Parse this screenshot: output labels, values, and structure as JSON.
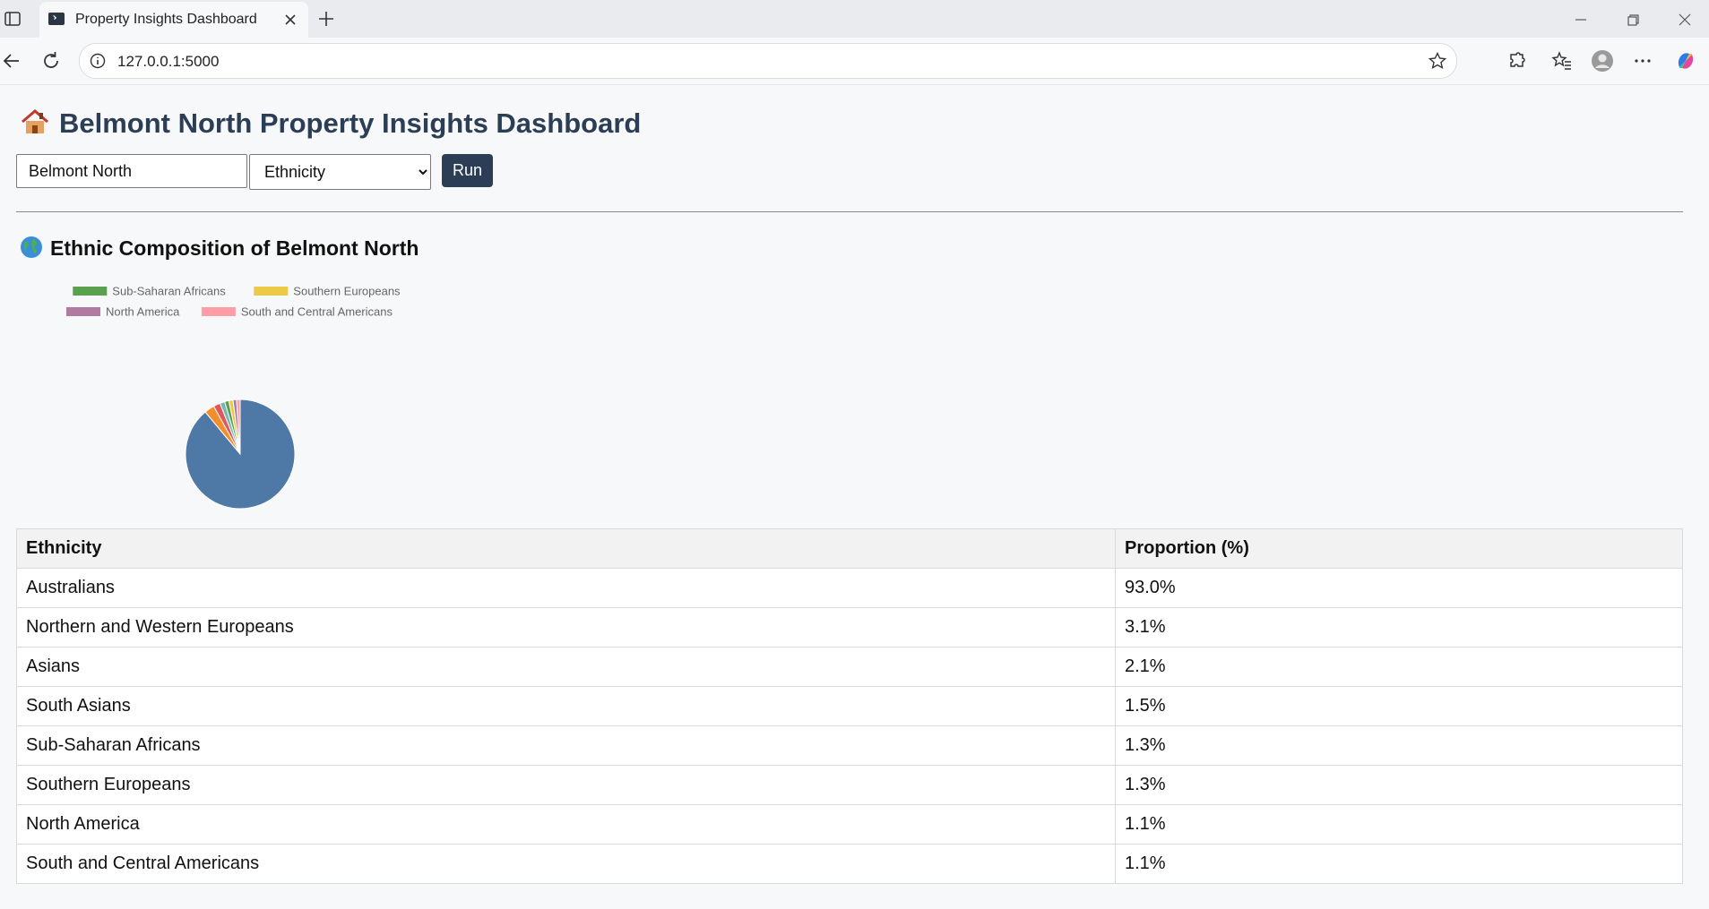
{
  "browser": {
    "tab_title": "Property Insights Dashboard",
    "url": "127.0.0.1:5000"
  },
  "header": {
    "title": "Belmont North Property Insights Dashboard",
    "title_icon": "house-icon"
  },
  "controls": {
    "suburb_value": "Belmont North",
    "category_selected": "Ethnicity",
    "run_label": "Run"
  },
  "section": {
    "title": "Ethnic Composition of Belmont North",
    "icon": "globe-icon"
  },
  "chart_data": {
    "type": "pie",
    "legend_position": "top",
    "labels": [
      "Australians",
      "Northern and Western Europeans",
      "Asians",
      "South Asians",
      "Sub-Saharan Africans",
      "Southern Europeans",
      "North America",
      "South and Central Americans"
    ],
    "values": [
      93.0,
      3.1,
      2.1,
      1.5,
      1.3,
      1.3,
      1.1,
      1.1
    ],
    "colors": [
      "#4e79a7",
      "#f28e2b",
      "#e15759",
      "#76b7b2",
      "#59a14f",
      "#edc948",
      "#b07aa1",
      "#ff9da7"
    ]
  },
  "table": {
    "headers": [
      "Ethnicity",
      "Proportion (%)"
    ],
    "rows": [
      [
        "Australians",
        "93.0%"
      ],
      [
        "Northern and Western Europeans",
        "3.1%"
      ],
      [
        "Asians",
        "2.1%"
      ],
      [
        "South Asians",
        "1.5%"
      ],
      [
        "Sub-Saharan Africans",
        "1.3%"
      ],
      [
        "Southern Europeans",
        "1.3%"
      ],
      [
        "North America",
        "1.1%"
      ],
      [
        "South and Central Americans",
        "1.1%"
      ]
    ]
  }
}
